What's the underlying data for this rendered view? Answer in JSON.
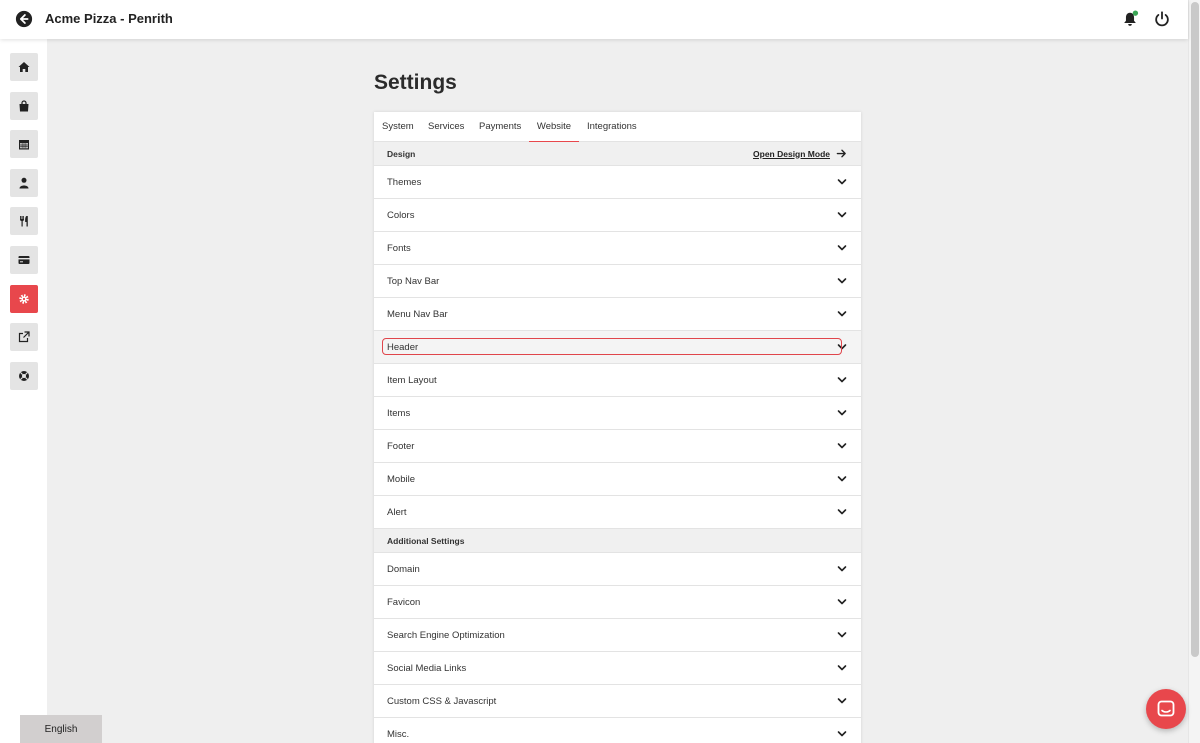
{
  "header": {
    "title": "Acme Pizza - Penrith"
  },
  "sidebar": {
    "items": [
      {
        "icon": "home-icon"
      },
      {
        "icon": "shopping-bag-icon"
      },
      {
        "icon": "calendar-icon"
      },
      {
        "icon": "user-icon"
      },
      {
        "icon": "utensils-icon"
      },
      {
        "icon": "credit-card-icon"
      },
      {
        "icon": "settings-cog-icon",
        "active": true
      },
      {
        "icon": "external-link-icon"
      },
      {
        "icon": "help-lifebuoy-icon"
      }
    ],
    "language": "English"
  },
  "page": {
    "title": "Settings"
  },
  "tabs": [
    "System",
    "Services",
    "Payments",
    "Website",
    "Integrations"
  ],
  "active_tab": "Website",
  "design": {
    "label": "Design",
    "link": "Open Design Mode",
    "rows": [
      "Themes",
      "Colors",
      "Fonts",
      "Top Nav Bar",
      "Menu Nav Bar",
      "Header",
      "Item Layout",
      "Items",
      "Footer",
      "Mobile",
      "Alert"
    ],
    "highlighted": "Header"
  },
  "additional": {
    "label": "Additional Settings",
    "rows": [
      "Domain",
      "Favicon",
      "Search Engine Optimization",
      "Social Media Links",
      "Custom CSS & Javascript",
      "Misc."
    ]
  },
  "colors": {
    "accent": "#e8474c",
    "notification_dot": "#3aa655"
  }
}
